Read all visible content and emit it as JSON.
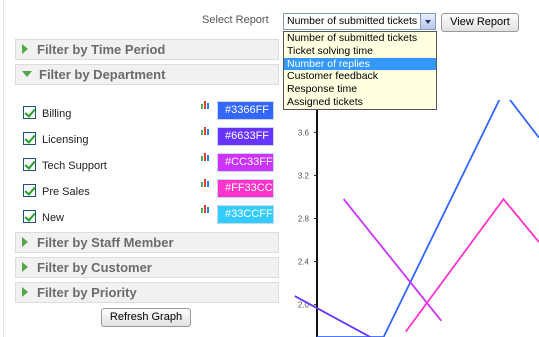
{
  "report": {
    "label": "Select Report",
    "selected": "Number of submitted tickets",
    "view_button": "View Report",
    "options": [
      "Number of submitted tickets",
      "Ticket solving time",
      "Number of replies",
      "Customer feedback",
      "Response time",
      "Assigned tickets"
    ],
    "highlighted_index": 2
  },
  "filters": {
    "time_period": "Filter by Time Period",
    "department": "Filter by Department",
    "staff": "Filter by Staff Member",
    "customer": "Filter by Customer",
    "priority": "Filter by Priority",
    "refresh_button": "Refresh Graph"
  },
  "departments": [
    {
      "name": "Billing",
      "color": "#3366FF",
      "checked": true
    },
    {
      "name": "Licensing",
      "color": "#6633FF",
      "checked": true
    },
    {
      "name": "Tech Support",
      "color": "#CC33FF",
      "checked": true
    },
    {
      "name": "Pre Sales",
      "color": "#FF33CC",
      "checked": true
    },
    {
      "name": "New",
      "color": "#33CCFF",
      "checked": true
    }
  ],
  "chart_data": {
    "type": "line",
    "y_ticks": [
      "3.6",
      "3.2",
      "2.8",
      "2.4",
      "2.0"
    ],
    "ylim": [
      1.7,
      3.9
    ],
    "series": [
      {
        "color": "#3366FF",
        "points": [
          [
            0.0,
            1.7
          ],
          [
            0.3,
            1.7
          ],
          [
            0.84,
            3.98
          ],
          [
            1.0,
            3.55
          ]
        ]
      },
      {
        "color": "#6633FF",
        "points": [
          [
            -0.1,
            2.08
          ],
          [
            0.24,
            1.7
          ]
        ]
      },
      {
        "color": "#CC33FF",
        "points": [
          [
            0.12,
            2.98
          ],
          [
            0.56,
            1.85
          ]
        ]
      },
      {
        "color": "#FF33CC",
        "points": [
          [
            0.4,
            1.75
          ],
          [
            0.84,
            2.98
          ],
          [
            1.0,
            2.58
          ]
        ]
      }
    ]
  }
}
